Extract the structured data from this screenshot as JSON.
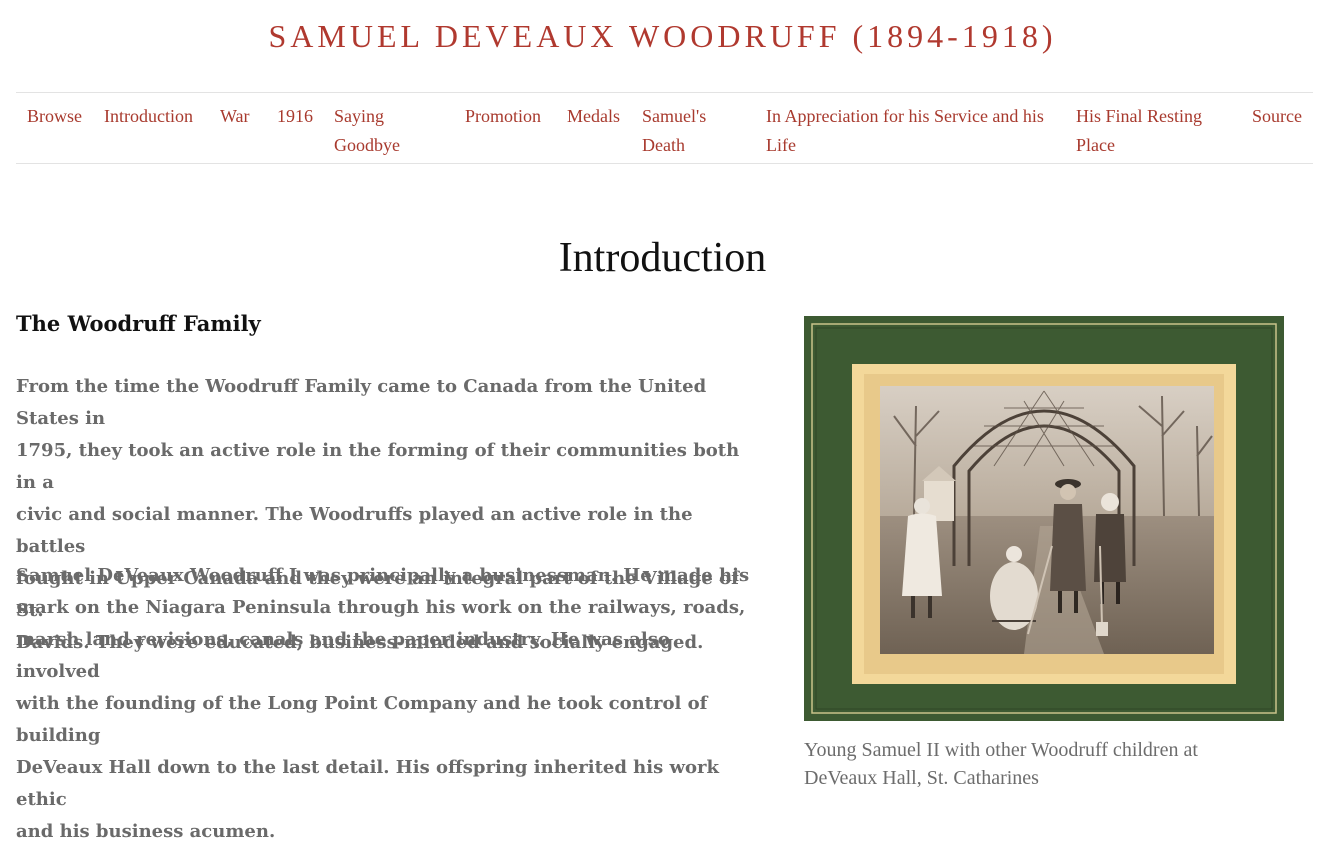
{
  "site": {
    "title": "SAMUEL DEVEAUX WOODRUFF (1894-1918)"
  },
  "nav": {
    "items": [
      {
        "line1": "Browse",
        "line2": ""
      },
      {
        "line1": "Introduction",
        "line2": ""
      },
      {
        "line1": "War",
        "line2": ""
      },
      {
        "line1": "1916",
        "line2": ""
      },
      {
        "line1": "Saying",
        "line2": "Goodbye"
      },
      {
        "line1": "Promotion",
        "line2": ""
      },
      {
        "line1": "Medals",
        "line2": ""
      },
      {
        "line1": "Samuel's",
        "line2": "Death"
      },
      {
        "line1": "In Appreciation for his Service and his",
        "line2": "Life"
      },
      {
        "line1": "His Final Resting",
        "line2": "Place"
      },
      {
        "line1": "Source",
        "line2": ""
      }
    ],
    "link_color": "#a83a2e"
  },
  "page": {
    "heading": "Introduction",
    "section_heading": "The Woodruff Family",
    "paragraphs": [
      {
        "lines": [
          "From the time the Woodruff Family came to Canada from the United States in",
          "1795, they took an active role in the forming of their communities both in a",
          "civic and social manner. The Woodruffs played an active role in the battles",
          "fought in Upper Canada and they were an integral part of the Village of St.",
          "Davids. They were educated, business-minded and socially engaged."
        ]
      },
      {
        "lines": [
          "Samuel DeVeaux Woodruff I was principally a businessman. He made his",
          "mark on the Niagara Peninsula through his work on the railways, roads,",
          "marsh land revisions, canals and the paper industry. He was also involved",
          "with the founding of the Long Point Company and he took control of building",
          "DeVeaux Hall down to the last detail. His offspring inherited his work ethic",
          "and his business acumen."
        ]
      }
    ],
    "figure": {
      "caption_line1": "Young Samuel II with other Woodruff children at",
      "caption_line2": "DeVeaux Hall, St. Catharines",
      "mat_color": "#3d5a32",
      "inner_mat_color": "#f3d89a",
      "photo_tone": "#a89a8a"
    }
  }
}
